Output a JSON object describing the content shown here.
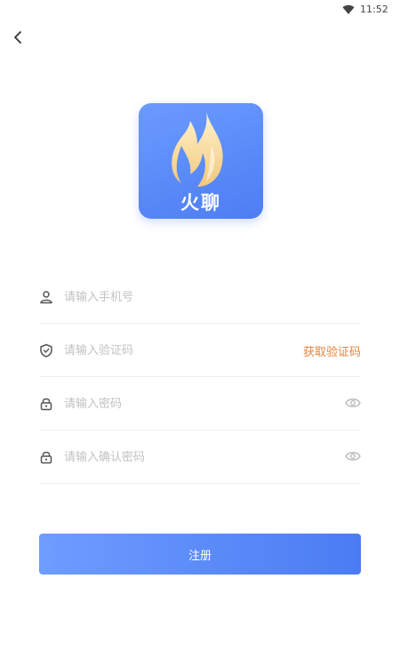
{
  "status_bar": {
    "time": "11:52",
    "wifi_icon": "wifi-icon"
  },
  "nav": {
    "back_icon": "chevron-left-icon"
  },
  "logo": {
    "text": "火聊",
    "background": "#5b8cf7"
  },
  "form": {
    "phone": {
      "placeholder": "请输入手机号",
      "value": "",
      "icon": "user-icon"
    },
    "code": {
      "placeholder": "请输入验证码",
      "value": "",
      "icon": "verify-icon",
      "action_label": "获取验证码"
    },
    "password": {
      "placeholder": "请输入密码",
      "value": "",
      "icon": "lock-icon",
      "toggle_icon": "eye-icon"
    },
    "confirm_password": {
      "placeholder": "请输入确认密码",
      "value": "",
      "icon": "lock-icon",
      "toggle_icon": "eye-icon"
    }
  },
  "register_button": {
    "label": "注册"
  },
  "colors": {
    "accent": "#e8833a",
    "primary": "#4b7cf3",
    "placeholder": "#c2c2c2",
    "divider": "#eeeeee"
  }
}
